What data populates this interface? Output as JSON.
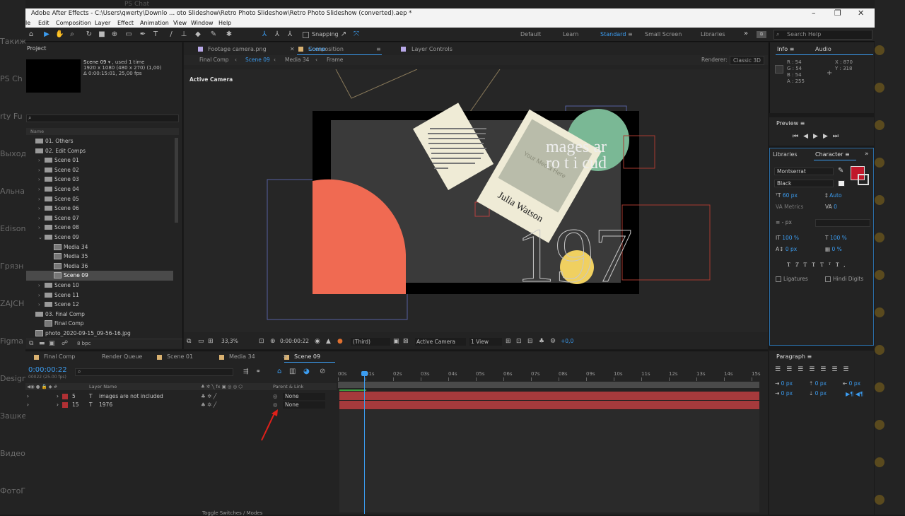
{
  "window": {
    "title": "Adobe After Effects - C:\\Users\\qwerty\\Downlo ... oto Slideshow\\Retro Photo Slideshow\\Retro Photo Slideshow (converted).aep *",
    "topstrip": "PS Chat"
  },
  "background_left": [
    "Такиж",
    "PS Ch",
    "rty Fu",
    "Выход",
    "Альна",
    "Edison",
    "Грязн",
    "ZAJCH",
    "Figma",
    "Design",
    "Зашке",
    "Видео",
    "ФотоГ"
  ],
  "menu": [
    "le",
    "Edit",
    "Composition",
    "Layer",
    "Effect",
    "Animation",
    "View",
    "Window",
    "Help"
  ],
  "toolbar": {
    "snapping_label": "Snapping",
    "workspaces": [
      "Default",
      "Learn",
      "Standard",
      "Small Screen",
      "Libraries"
    ],
    "active_workspace": "Standard",
    "search_placeholder": "Search Help",
    "more": "»"
  },
  "project": {
    "title": "Project",
    "item_name": "Scene 09",
    "used": ", used 1 time",
    "dims": "1920 x 1080  (480 x 270) (1,00)",
    "duration": "Δ 0:00:15:01, 25,00 fps",
    "col_name": "Name",
    "rows": [
      {
        "label": "01. Others",
        "kind": "folder",
        "indent": 0,
        "arrow": ""
      },
      {
        "label": "02. Edit Comps",
        "kind": "folder",
        "indent": 0,
        "arrow": ""
      },
      {
        "label": "Scene 01",
        "kind": "folder",
        "indent": 1,
        "arrow": "›"
      },
      {
        "label": "Scene 02",
        "kind": "folder",
        "indent": 1,
        "arrow": "›"
      },
      {
        "label": "Scene 03",
        "kind": "folder",
        "indent": 1,
        "arrow": "›"
      },
      {
        "label": "Scene 04",
        "kind": "folder",
        "indent": 1,
        "arrow": "›"
      },
      {
        "label": "Scene 05",
        "kind": "folder",
        "indent": 1,
        "arrow": "›"
      },
      {
        "label": "Scene 06",
        "kind": "folder",
        "indent": 1,
        "arrow": "›"
      },
      {
        "label": "Scene 07",
        "kind": "folder",
        "indent": 1,
        "arrow": "›"
      },
      {
        "label": "Scene 08",
        "kind": "folder",
        "indent": 1,
        "arrow": "›"
      },
      {
        "label": "Scene 09",
        "kind": "folder",
        "indent": 1,
        "arrow": "⌄"
      },
      {
        "label": "Media 34",
        "kind": "comp",
        "indent": 2,
        "arrow": ""
      },
      {
        "label": "Media 35",
        "kind": "comp",
        "indent": 2,
        "arrow": ""
      },
      {
        "label": "Media 36",
        "kind": "comp",
        "indent": 2,
        "arrow": ""
      },
      {
        "label": "Scene 09",
        "kind": "comp",
        "indent": 2,
        "arrow": "",
        "selected": true
      },
      {
        "label": "Scene 10",
        "kind": "folder",
        "indent": 1,
        "arrow": "›"
      },
      {
        "label": "Scene 11",
        "kind": "folder",
        "indent": 1,
        "arrow": "›"
      },
      {
        "label": "Scene 12",
        "kind": "folder",
        "indent": 1,
        "arrow": "›"
      },
      {
        "label": "03. Final Comp",
        "kind": "folder",
        "indent": 0,
        "arrow": ""
      },
      {
        "label": "Final Comp",
        "kind": "comp",
        "indent": 1,
        "arrow": ""
      },
      {
        "label": "photo_2020-09-15_09-56-16.jpg",
        "kind": "file",
        "indent": 0,
        "arrow": ""
      }
    ],
    "bpc": "8 bpc"
  },
  "composition": {
    "tabs": [
      "Footage camera.png",
      "Composition Scene 09",
      "Layer Controls"
    ],
    "comp_prefix": "Composition",
    "comp_name": "Scene 09",
    "sub": [
      "Final Comp",
      "Scene 09",
      "Media 34",
      "Frame"
    ],
    "renderer_label": "Renderer:",
    "renderer": "Classic 3D",
    "active_camera": "Active Camera",
    "canvas_text_1": "mages  ar",
    "canvas_text_2": "ro  t i  cud",
    "canvas_name": "Julia Watson",
    "canvas_media": "Your Media Here",
    "canvas_year": "197",
    "zoom": "33,3%",
    "timecode": "0:00:00:22",
    "resolution": "(Third)",
    "camera": "Active Camera",
    "view": "1 View",
    "exposure": "+0,0"
  },
  "info": {
    "tab1": "Info",
    "tab2": "Audio",
    "r": "R : 54",
    "g": "G : 54",
    "b": "B : 54",
    "a": "A : 255",
    "x": "X : 870",
    "y": "Y : 318"
  },
  "preview": {
    "title": "Preview"
  },
  "character": {
    "tab1": "Libraries",
    "tab2": "Character",
    "font": "Montserrat",
    "style": "Black",
    "size": "60 px",
    "leading": "Auto",
    "kerning": "Metrics",
    "tracking": "0",
    "stroke": "- px",
    "vscale": "100 %",
    "hscale": "100 %",
    "baseline": "0 px",
    "tsume": "0 %",
    "ligatures": "Ligatures",
    "hindi": "Hindi Digits",
    "fill_color": "#c0182a"
  },
  "paragraph": {
    "title": "Paragraph",
    "v1": "0 px",
    "v2": "0 px",
    "v3": "0 px",
    "v4": "0 px",
    "v5": "0 px"
  },
  "timeline": {
    "tabs": [
      "Final Comp",
      "Render Queue",
      "Scene 01",
      "Media 34",
      "Scene 09"
    ],
    "timecode": "0:00:00:22",
    "frame": "00022 (25.00 fps)",
    "col_layer": "Layer Name",
    "col_parent": "Parent & Link",
    "layers": [
      {
        "num": "5",
        "name": "images are not included",
        "parent": "None"
      },
      {
        "num": "15",
        "name": "1976",
        "parent": "None"
      }
    ],
    "ruler": [
      "00s",
      "01s",
      "02s",
      "03s",
      "04s",
      "05s",
      "06s",
      "07s",
      "08s",
      "09s",
      "10s",
      "11s",
      "12s",
      "13s",
      "14s",
      "15s"
    ],
    "footer": "Toggle Switches / Modes",
    "layer_color": "#b03034"
  }
}
